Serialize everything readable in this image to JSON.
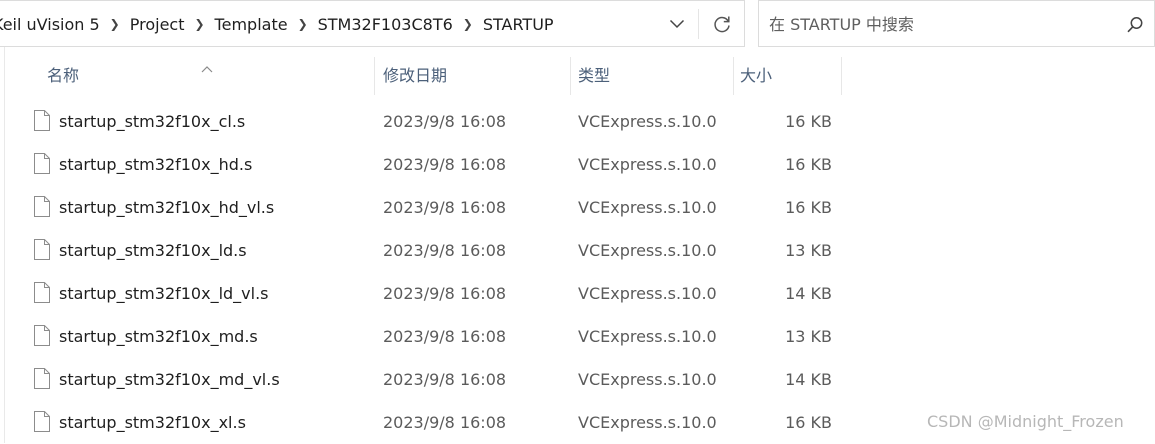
{
  "breadcrumb": [
    "Keil uVision 5",
    "Project",
    "Template",
    "STM32F103C8T6",
    "STARTUP"
  ],
  "search": {
    "placeholder": "在 STARTUP 中搜索"
  },
  "icons": {
    "address_dropdown": "chevron-down-icon",
    "refresh": "refresh-icon",
    "search": "search-icon",
    "sort": "sort-up-icon",
    "file": "file-icon"
  },
  "columns": {
    "name": "名称",
    "date_modified": "修改日期",
    "type": "类型",
    "size": "大小"
  },
  "files": [
    {
      "name": "startup_stm32f10x_cl.s",
      "date": "2023/9/8 16:08",
      "type": "VCExpress.s.10.0",
      "size": "16 KB"
    },
    {
      "name": "startup_stm32f10x_hd.s",
      "date": "2023/9/8 16:08",
      "type": "VCExpress.s.10.0",
      "size": "16 KB"
    },
    {
      "name": "startup_stm32f10x_hd_vl.s",
      "date": "2023/9/8 16:08",
      "type": "VCExpress.s.10.0",
      "size": "16 KB"
    },
    {
      "name": "startup_stm32f10x_ld.s",
      "date": "2023/9/8 16:08",
      "type": "VCExpress.s.10.0",
      "size": "13 KB"
    },
    {
      "name": "startup_stm32f10x_ld_vl.s",
      "date": "2023/9/8 16:08",
      "type": "VCExpress.s.10.0",
      "size": "14 KB"
    },
    {
      "name": "startup_stm32f10x_md.s",
      "date": "2023/9/8 16:08",
      "type": "VCExpress.s.10.0",
      "size": "13 KB"
    },
    {
      "name": "startup_stm32f10x_md_vl.s",
      "date": "2023/9/8 16:08",
      "type": "VCExpress.s.10.0",
      "size": "14 KB"
    },
    {
      "name": "startup_stm32f10x_xl.s",
      "date": "2023/9/8 16:08",
      "type": "VCExpress.s.10.0",
      "size": "16 KB"
    }
  ],
  "watermark": "CSDN @Midnight_Frozen",
  "colors": {
    "header_text": "#4c607a",
    "secondary_text": "#5b5b5b",
    "border": "#dcdcdc"
  }
}
